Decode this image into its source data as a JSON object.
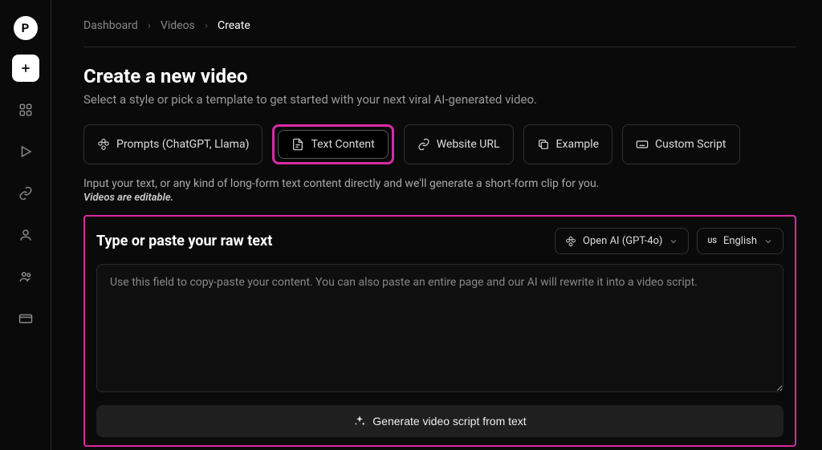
{
  "logo_letter": "P",
  "breadcrumb": {
    "items": [
      "Dashboard",
      "Videos",
      "Create"
    ],
    "active_index": 2
  },
  "page": {
    "title": "Create a new video",
    "subtitle": "Select a style or pick a template to get started with your next viral AI-generated video."
  },
  "tabs": {
    "prompts": "Prompts (ChatGPT, Llama)",
    "text_content": "Text Content",
    "website_url": "Website URL",
    "example": "Example",
    "custom_script": "Custom Script"
  },
  "helper": {
    "text": "Input your text, or any kind of long-form text content directly and we'll generate a short-form clip for you.",
    "note": "Videos are editable."
  },
  "panel": {
    "title": "Type or paste your raw text",
    "model_label": "Open AI (GPT-4o)",
    "lang_flag": "US",
    "lang_label": "English",
    "placeholder": "Use this field to copy-paste your content. You can also paste an entire page and our AI will rewrite it into a video script.",
    "generate_label": "Generate video script from text"
  }
}
